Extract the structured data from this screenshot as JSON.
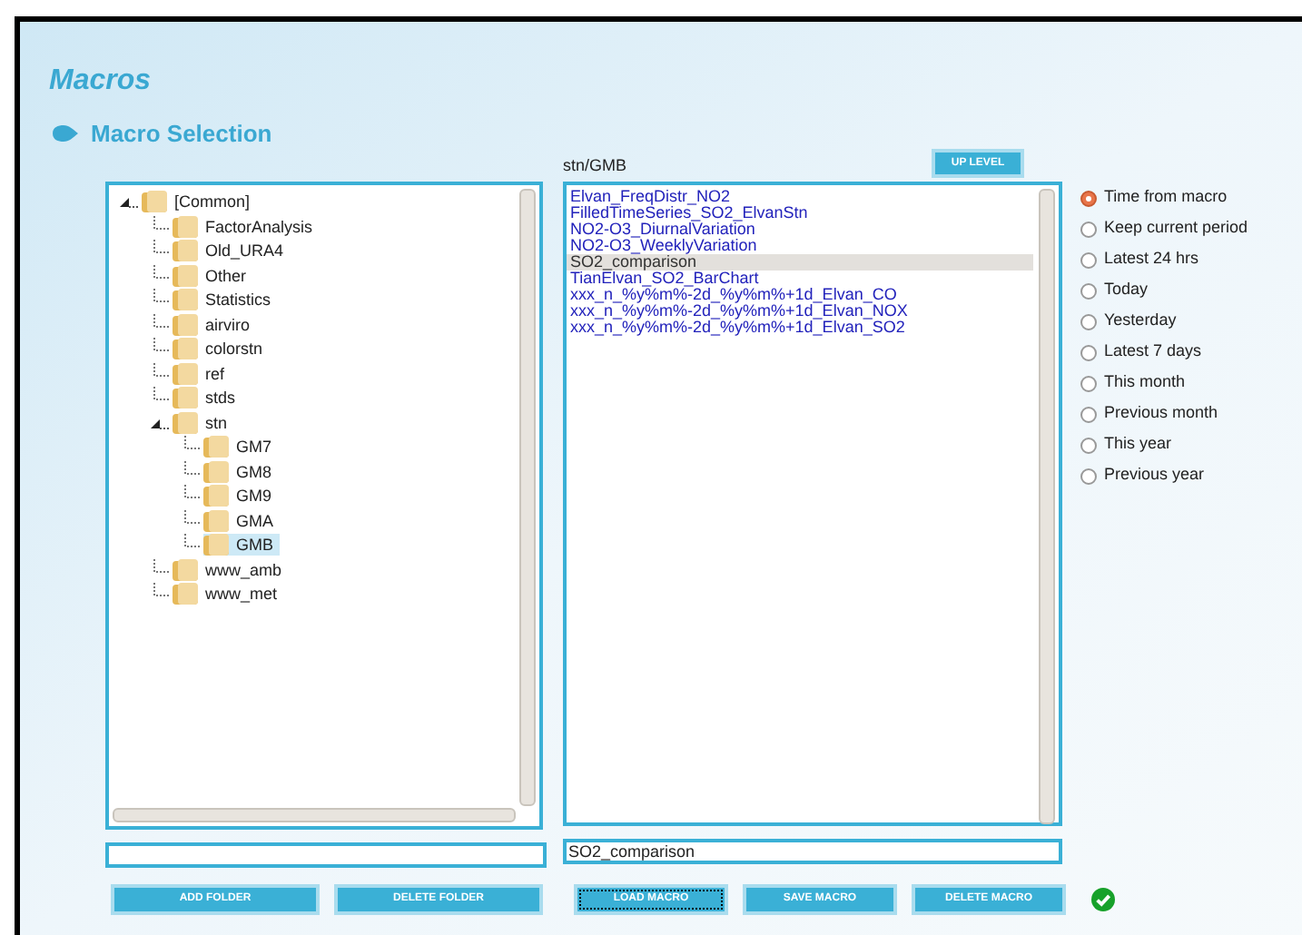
{
  "page_title": "Macros",
  "section_title": "Macro Selection",
  "current_path": "stn/GMB",
  "up_level_button": "UP LEVEL",
  "folder_tree": [
    {
      "label": "[Common]",
      "expanded": true,
      "selected": false,
      "children": [
        {
          "label": "FactorAnalysis",
          "selected": false
        },
        {
          "label": "Old_URA4",
          "selected": false
        },
        {
          "label": "Other",
          "selected": false
        },
        {
          "label": "Statistics",
          "selected": false
        },
        {
          "label": "airviro",
          "selected": false
        },
        {
          "label": "colorstn",
          "selected": false
        },
        {
          "label": "ref",
          "selected": false
        },
        {
          "label": "stds",
          "selected": false
        },
        {
          "label": "stn",
          "expanded": true,
          "selected": false,
          "children": [
            {
              "label": "GM7",
              "selected": false
            },
            {
              "label": "GM8",
              "selected": false
            },
            {
              "label": "GM9",
              "selected": false
            },
            {
              "label": "GMA",
              "selected": false
            },
            {
              "label": "GMB",
              "selected": true
            }
          ]
        },
        {
          "label": "www_amb",
          "selected": false
        },
        {
          "label": "www_met",
          "selected": false
        }
      ]
    }
  ],
  "macros": [
    {
      "label": "Elvan_FreqDistr_NO2",
      "selected": false
    },
    {
      "label": "FilledTimeSeries_SO2_ElvanStn",
      "selected": false
    },
    {
      "label": "NO2-O3_DiurnalVariation",
      "selected": false
    },
    {
      "label": "NO2-O3_WeeklyVariation",
      "selected": false
    },
    {
      "label": "SO2_comparison",
      "selected": true
    },
    {
      "label": "TianElvan_SO2_BarChart",
      "selected": false
    },
    {
      "label": "xxx_n_%y%m%-2d_%y%m%+1d_Elvan_CO",
      "selected": false
    },
    {
      "label": "xxx_n_%y%m%-2d_%y%m%+1d_Elvan_NOX",
      "selected": false
    },
    {
      "label": "xxx_n_%y%m%-2d_%y%m%+1d_Elvan_SO2",
      "selected": false
    }
  ],
  "period_options": [
    {
      "label": "Time from macro",
      "selected": true
    },
    {
      "label": "Keep current period",
      "selected": false
    },
    {
      "label": "Latest 24 hrs",
      "selected": false
    },
    {
      "label": "Today",
      "selected": false
    },
    {
      "label": "Yesterday",
      "selected": false
    },
    {
      "label": "Latest 7 days",
      "selected": false
    },
    {
      "label": "This month",
      "selected": false
    },
    {
      "label": "Previous month",
      "selected": false
    },
    {
      "label": "This year",
      "selected": false
    },
    {
      "label": "Previous year",
      "selected": false
    }
  ],
  "macro_name_field": {
    "value": "SO2_comparison"
  },
  "folder_buttons": [
    {
      "label": "ADD FOLDER",
      "focused": false
    },
    {
      "label": "DELETE FOLDER",
      "focused": false
    }
  ],
  "macro_buttons": [
    {
      "label": "LOAD MACRO",
      "focused": true
    },
    {
      "label": "SAVE MACRO",
      "focused": false
    },
    {
      "label": "DELETE MACRO",
      "focused": false
    }
  ],
  "status_ok": true
}
